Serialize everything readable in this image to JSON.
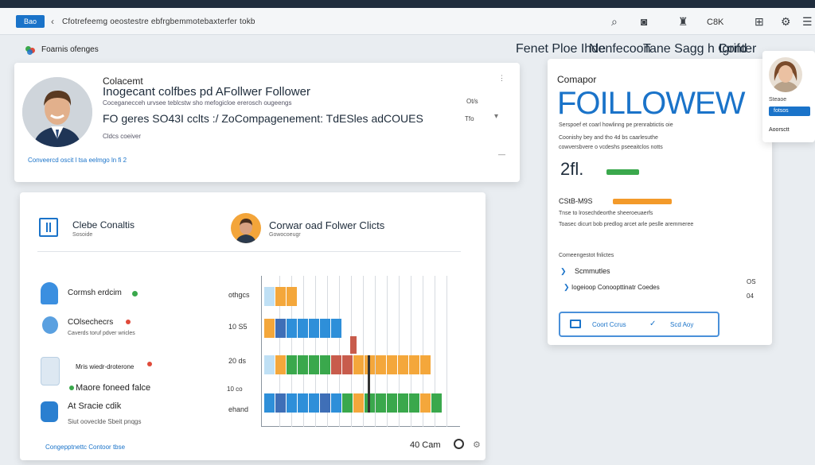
{
  "chrome": {
    "tab_label": "Bao",
    "url": "Cfotrefeemg oeostestre ebfrgbemmotebaxterfer tokb",
    "right_label": "C8K"
  },
  "subnav": {
    "brand": "Foarnis ofenges",
    "links": [
      "Fenet Ploe Ihde",
      "Nenfecoon",
      "Tane Sagg h Conter",
      "Igrifd"
    ]
  },
  "profile_card": {
    "name": "Colacemt",
    "headline": "Inogecant colfbes pd AFollwer Follower",
    "meta": "Coceganecceh urvsee teblcstw sho mefogicloe ererosch ougeengs",
    "stats_line": "FO geres SO43I cclts :/ ZoCompagenement: TdESles adCOUES",
    "sub": "Cldcs coeiver",
    "link": "Conveercd oscit l tsa eelmgo ln fi 2",
    "right1": "Ot/s",
    "right2": "Tfo"
  },
  "follower_panel": {
    "left_title": "Clebe Conaltis",
    "left_sub": "Sosoide",
    "center_title": "Corwar oad Folwer Clicts",
    "center_sub": "Gowocoeugr",
    "rows": [
      {
        "label": "Cormsh erdcim",
        "sub": "",
        "value": "othgcs"
      },
      {
        "label": "COlsechecrs",
        "sub": "Caverds toruf pdver wricles",
        "value": "10 S5"
      },
      {
        "label": "Mris wiedr-droterone",
        "sub": "",
        "value": "20 ds"
      },
      {
        "label": "Maore foneed falce",
        "sub": "",
        "value": "10 co"
      },
      {
        "label": "At Sracie cdik",
        "sub": "Siut ooveclde Sbeit pnqgs",
        "value": "ehand"
      }
    ],
    "footer_link": "Congepptnettc Contoor tbse",
    "footer_count": "40 Cam"
  },
  "chart_data": {
    "type": "bar",
    "categories": [
      "othgcs",
      "10 S5",
      "20 ds",
      "10 co",
      "ehand"
    ],
    "series": [
      {
        "values": [
          1,
          0,
          1,
          0,
          0
        ],
        "color": "#f4a73b"
      },
      {
        "values": [
          0,
          1,
          0,
          0,
          0
        ],
        "color": "#3f6fb7"
      },
      {
        "values": [
          0,
          0,
          1,
          0,
          1
        ],
        "color": "#2e8fd9"
      }
    ]
  },
  "stats_card": {
    "kicker": "Comapor",
    "big_title": "FOILLOWEW",
    "desc": "Serspoef et coarl howlinng pe prenrabtictis oie",
    "desc2": "Coonishy bey and tho 4d bs caarlesuthe",
    "desc3": "cowversbvere o vcdeshs pseeaitclos notts",
    "metric1": "2fl.",
    "metric2": "CStB-M9S",
    "metric_text": "Tnse to lrosechdeorthe sheeroeuaerfs",
    "metric_text2": "Toasec dicurt bob predlog arcet arle peslle aremmeree",
    "section_label": "Comeengestot fnlictes",
    "section_title": "Scmmutles",
    "section_item": "Iogeioop Conoopttinatr Coedes",
    "right_vals": [
      "OS",
      "04"
    ],
    "button_left": "Coort Ccrus",
    "button_right": "Scd Aoy",
    "metric1_fill": 0.55,
    "metric2_fill": 0.9
  },
  "side_card": {
    "label": "Steaoe",
    "button": "fotsos",
    "tag": "Aoorsctt"
  },
  "colors": {
    "accent": "#1a73c9",
    "green": "#3aa84c",
    "orange": "#f4a73b",
    "blue": "#2e8fd9",
    "red": "#c85c4c",
    "navy": "#1f2d3d"
  }
}
